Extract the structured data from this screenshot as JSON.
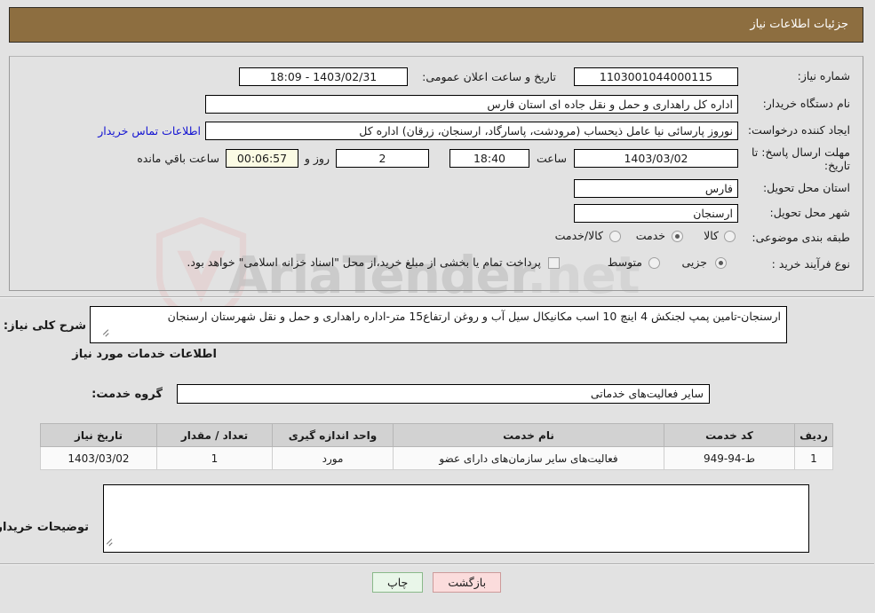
{
  "header": {
    "title": "جزئیات اطلاعات نیاز",
    "bar_color": "#8d6e40"
  },
  "watermark": {
    "text_main": "AriaTender",
    "text_tail": ".net"
  },
  "info": {
    "need_number_label": "شماره نیاز:",
    "need_number_value": "1103001044000115",
    "announce_label": "تاریخ و ساعت اعلان عمومی:",
    "announce_value": "1403/02/31 - 18:09",
    "buyer_org_label": "نام دستگاه خریدار:",
    "buyer_org_value": "اداره کل راهداری و حمل و نقل جاده ای استان فارس",
    "creator_label": "ایجاد کننده درخواست:",
    "creator_value": "نوروز پارسائی نیا عامل ذیحساب (مرودشت، پاسارگاد، ارسنجان، زرقان) اداره کل",
    "contact_link": "اطلاعات تماس خریدار",
    "deadline_label": "مهلت ارسال پاسخ: تا تاریخ:",
    "deadline_date": "1403/03/02",
    "hour_label": "ساعت",
    "deadline_time": "18:40",
    "days_value": "2",
    "days_label": "روز و",
    "countdown_value": "00:06:57",
    "countdown_label": "ساعت باقي مانده",
    "province_label": "استان محل تحویل:",
    "province_value": "فارس",
    "city_label": "شهر محل تحویل:",
    "city_value": "ارسنجان",
    "category_label": "طبقه بندی موضوعی:",
    "category_options": [
      {
        "label": "کالا",
        "selected": false
      },
      {
        "label": "خدمت",
        "selected": true
      },
      {
        "label": "کالا/خدمت",
        "selected": false
      }
    ],
    "process_label": "نوع فرآیند خرید :",
    "process_options": [
      {
        "label": "جزیی",
        "selected": true
      },
      {
        "label": "متوسط",
        "selected": false
      }
    ],
    "treasury_checkbox_checked": false,
    "treasury_note": "پرداخت تمام یا بخشی از مبلغ خرید،از محل \"اسناد خزانه اسلامی\" خواهد بود."
  },
  "need_description": {
    "label": "شرح کلی نیاز:",
    "value": "ارسنجان-تامین پمپ لجنکش 4 اینچ 10 اسب مکانیکال سیل آب و روغن ارتفاع15 متر-اداره راهداری و حمل و نقل شهرستان ارسنجان"
  },
  "services_section": {
    "title": "اطلاعات خدمات مورد نیاز",
    "group_label": "گروه خدمت:",
    "group_value": "سایر فعالیت‌های خدماتی"
  },
  "table": {
    "columns": [
      "ردیف",
      "کد خدمت",
      "نام خدمت",
      "واحد اندازه گیری",
      "تعداد / مقدار",
      "تاریخ نیاز"
    ],
    "rows": [
      {
        "row_no": "1",
        "service_code": "ط-94-949",
        "service_name": "فعالیت‌های سایر سازمان‌های دارای عضو",
        "unit": "مورد",
        "quantity": "1",
        "need_date": "1403/03/02"
      }
    ]
  },
  "buyer_notes": {
    "label": "توضیحات خریدار:",
    "value": ""
  },
  "footer": {
    "print_label": "چاپ",
    "back_label": "بازگشت"
  }
}
